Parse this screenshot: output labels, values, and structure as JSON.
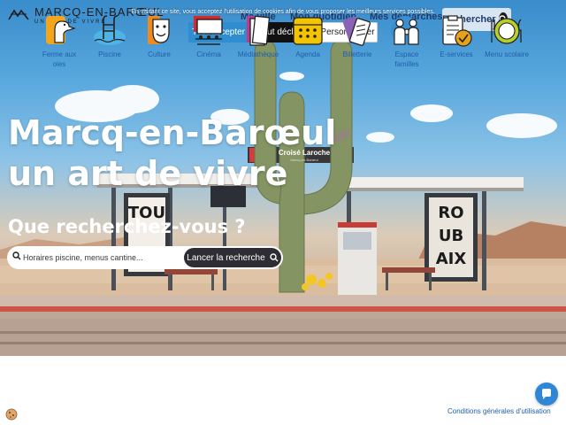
{
  "site": {
    "logo_name": "MARCQ-EN-BARŒUL",
    "logo_tagline": "UN ART DE VIVRE"
  },
  "nav": {
    "items": [
      {
        "label": "Ma ville"
      },
      {
        "label": "Mon quotidien"
      },
      {
        "label": "Mes démarches"
      }
    ],
    "search_label": "Rechercher"
  },
  "cookie_banner": {
    "text": "En visitant ce site, vous acceptez l'utilisation de cookies afin de vous proposer les meilleurs services possibles.",
    "accept": "Tout accepter",
    "decline": "Tout décliner",
    "customize": "Personnaliser"
  },
  "hero": {
    "title_line1": "Marcq-en-Barœul",
    "title_line2": "un art de vivre",
    "question": "Que recherchez-vous ?",
    "search_placeholder": "Horaires piscine, menus cantine...",
    "search_button": "Lancer la recherche",
    "station_sign": "Croisé Laroche",
    "station_subsign": "Marcq-en-Barœul",
    "poster_left": "TOU",
    "poster_right": [
      "RO",
      "UB",
      "AIX"
    ]
  },
  "quick_links": [
    {
      "line1": "Ferme aux",
      "line2": "oies",
      "icon": "goose-icon",
      "color": "#f2a51d"
    },
    {
      "line1": "Piscine",
      "line2": "",
      "icon": "pool-icon",
      "color": "#4fb3e6"
    },
    {
      "line1": "Culture",
      "line2": "",
      "icon": "theater-masks-icon",
      "color": "#f08a1f"
    },
    {
      "line1": "Cinéma",
      "line2": "",
      "icon": "cinema-icon",
      "color": "#d8282a"
    },
    {
      "line1": "Médiathèque",
      "line2": "",
      "icon": "books-icon",
      "color": "#c23a8a"
    },
    {
      "line1": "Agenda",
      "line2": "",
      "icon": "calendar-icon",
      "color": "#f5c400"
    },
    {
      "line1": "Billetterie",
      "line2": "",
      "icon": "tickets-icon",
      "color": "#8a63b7"
    },
    {
      "line1": "Espace",
      "line2": "familles",
      "icon": "family-icon",
      "color": "#3a8fd1"
    },
    {
      "line1": "E-services",
      "line2": "",
      "icon": "clipboard-check-icon",
      "color": "#e8a21a"
    },
    {
      "line1": "Menu scolaire",
      "line2": "",
      "icon": "plate-cutlery-icon",
      "color": "#b6cf2a"
    }
  ],
  "footer": {
    "conditions": "Conditions générales d'utilisation"
  }
}
